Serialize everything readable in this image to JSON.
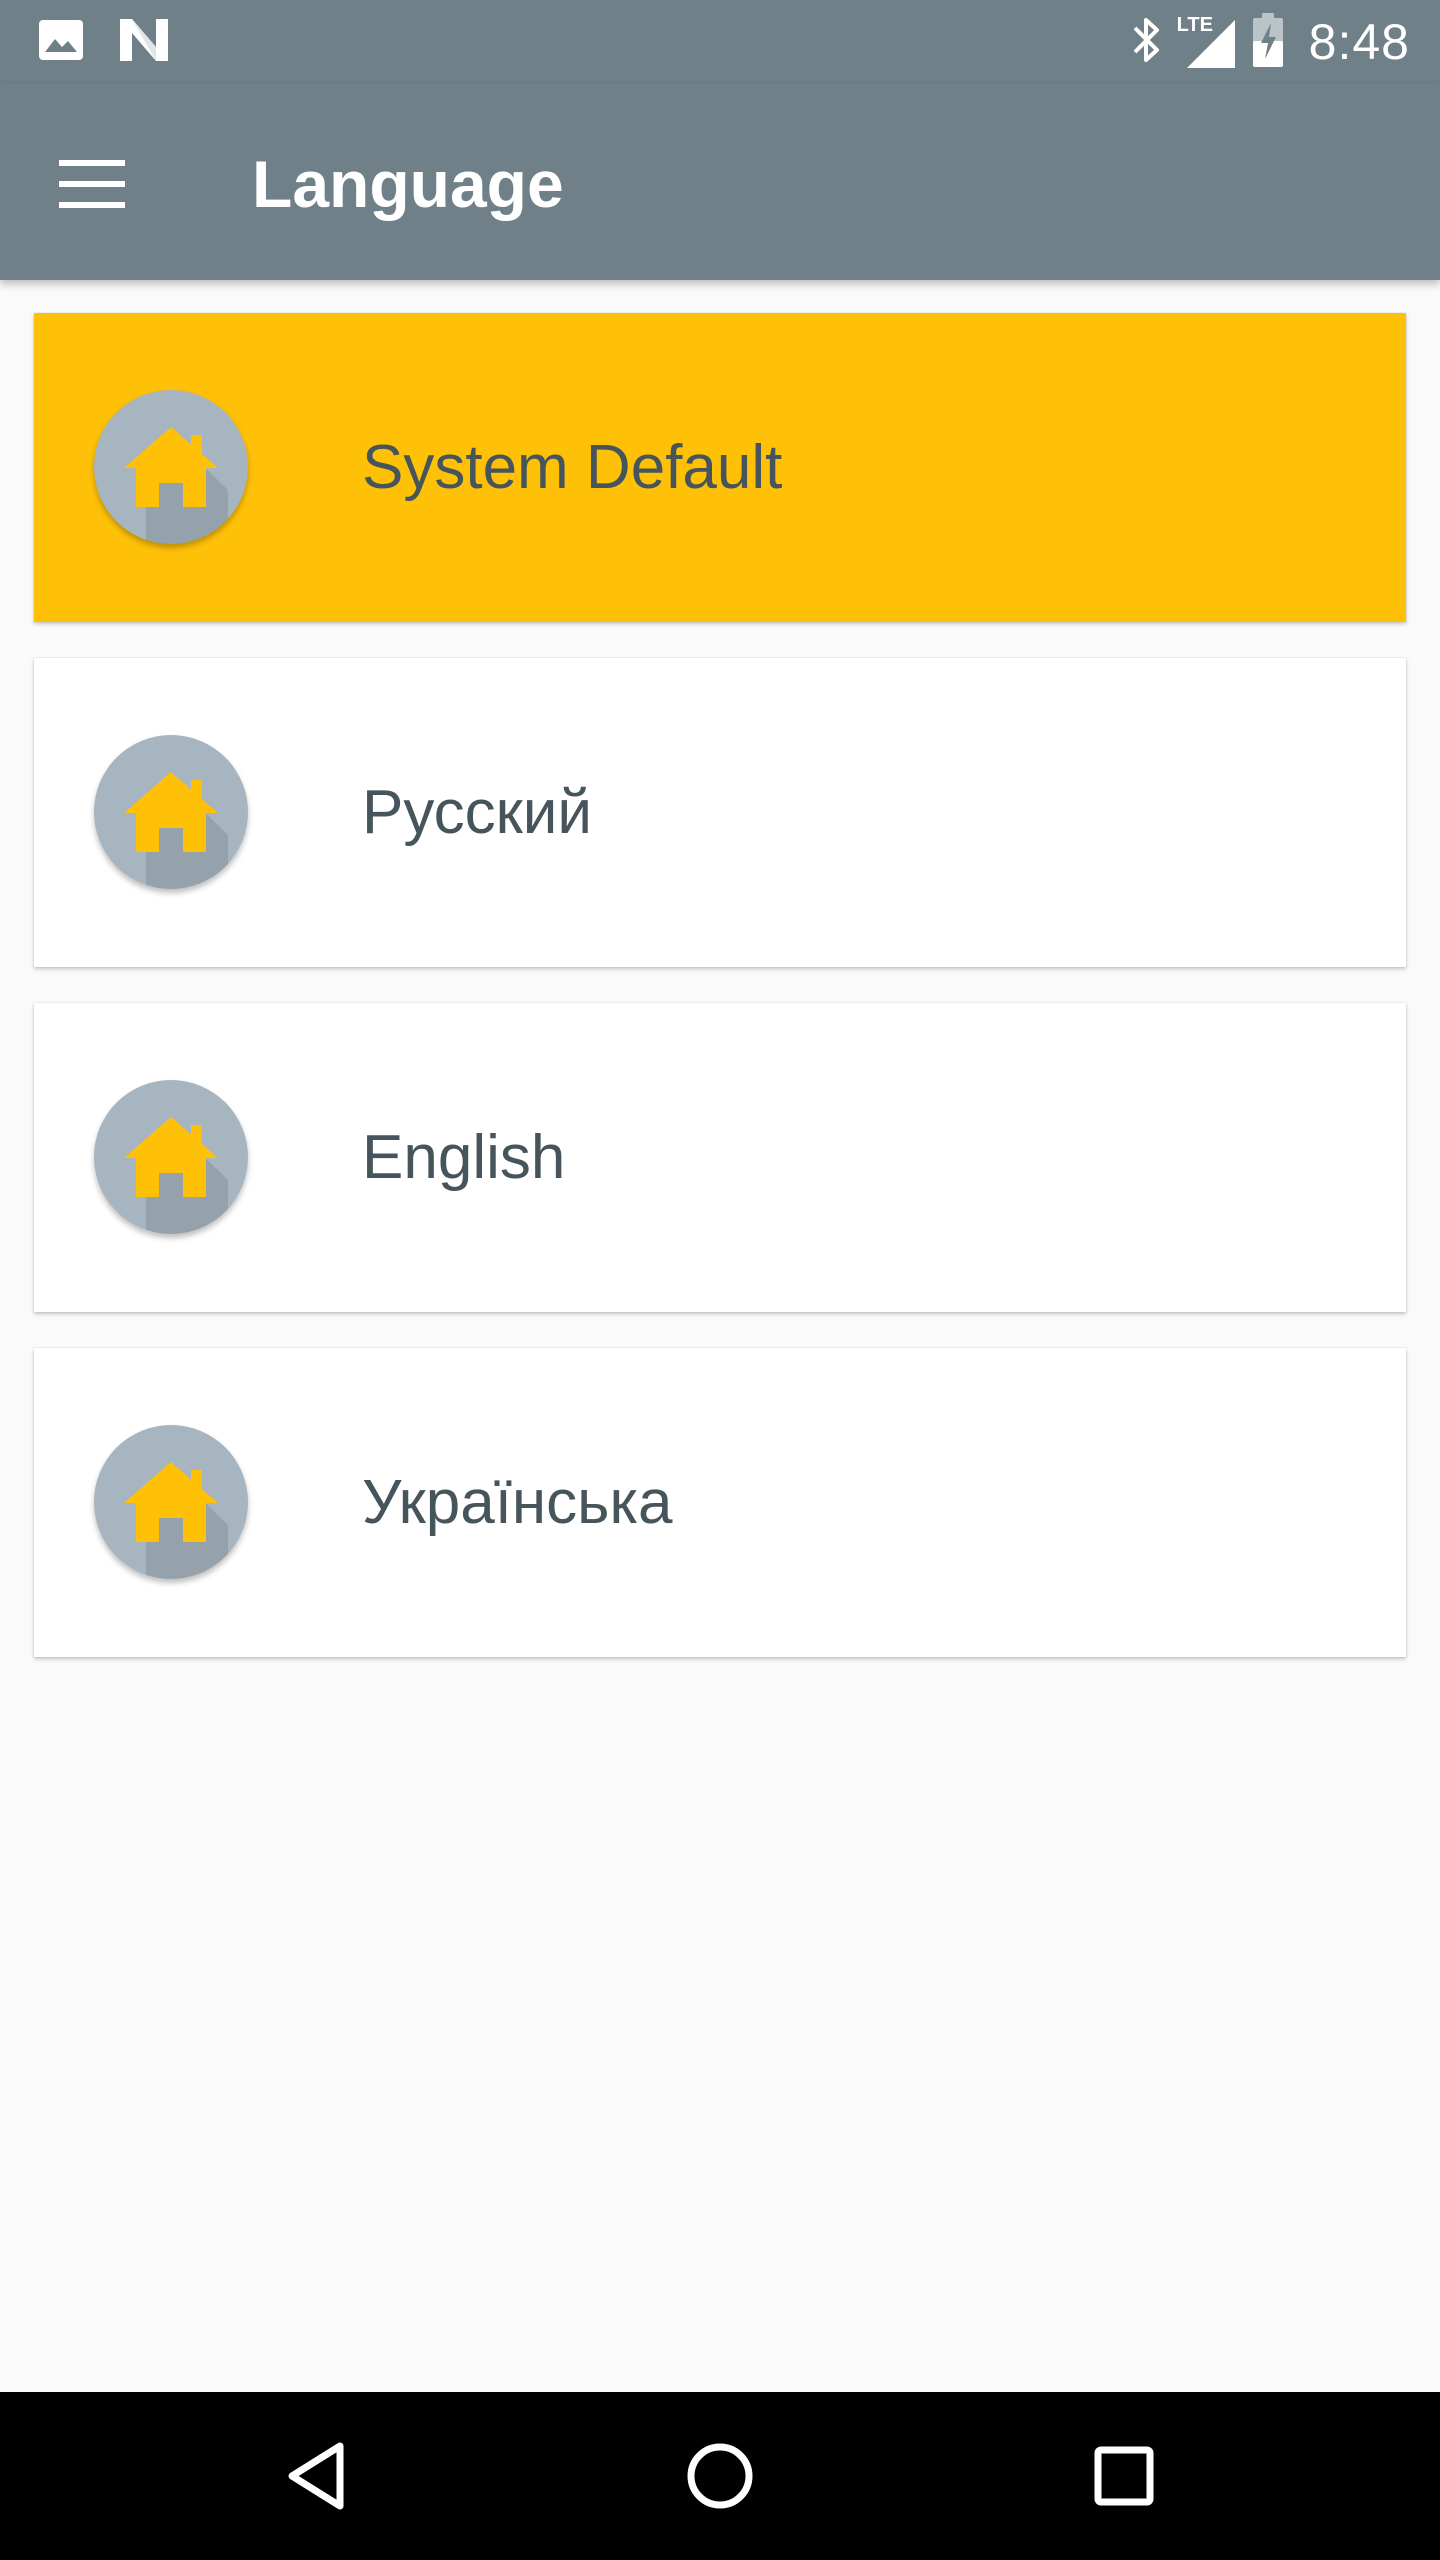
{
  "status_bar": {
    "time": "8:48",
    "icons": [
      "image-notification-icon",
      "n-notification-icon",
      "bluetooth-icon",
      "lte-signal-icon",
      "battery-charging-icon"
    ],
    "lte_label": "LTE"
  },
  "app_bar": {
    "title": "Language",
    "menu_icon": "hamburger-menu-icon"
  },
  "languages": [
    {
      "label": "System Default",
      "selected": true
    },
    {
      "label": "Русский",
      "selected": false
    },
    {
      "label": "English",
      "selected": false
    },
    {
      "label": "Українська",
      "selected": false
    }
  ],
  "list_icon": "home-icon",
  "colors": {
    "primary": "#6f8088",
    "accent": "#ffc107",
    "avatar_bg": "#a6b5bf",
    "text": "#46545b",
    "background": "#fafafa"
  },
  "nav_bar": {
    "icons": [
      "back-icon",
      "home-nav-icon",
      "recents-icon"
    ]
  }
}
